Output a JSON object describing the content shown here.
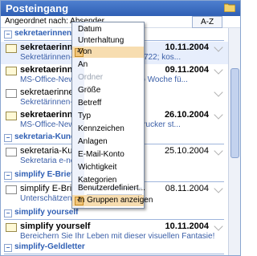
{
  "title": "Posteingang",
  "sort": {
    "label": "Angeordnet nach: Absender",
    "az": "A-Z"
  },
  "groups": [
    {
      "label": "sekretaerinnen...",
      "top": 0
    },
    {
      "label": "sekretaria-Kunde..."
    },
    {
      "label": "simplify E-Brief"
    },
    {
      "label": "simplify yourself"
    },
    {
      "label": "simplify-Geldletter"
    }
  ],
  "messages": [
    {
      "from": "sekretaerinnen...",
      "date": "10.11.2004",
      "preview": "Sekretärinnen-N... übersetzen ‪&#8722; kos...",
      "unread": true
    },
    {
      "from": "sekretaerinnen...",
      "date": "09.11.2004",
      "preview": "MS-Office-Newsl... Office Tipps pro Woche fü...",
      "unread": true
    },
    {
      "from": "sekretaerinnen.d...",
      "date": "",
      "preview": "Sekretärinnen-N... Kollegin?",
      "unread": false
    },
    {
      "from": "sekretaerinnen...",
      "date": "26.10.2004",
      "preview": "MS-Office-Newsl... den richtigen Drucker st...",
      "unread": true
    },
    {
      "from": "sekretaria-Kunde...",
      "date": "25.10.2004",
      "preview": "Sekretaria e-new...",
      "unread": false
    },
    {
      "from": "simplify E-Brief",
      "date": "08.11.2004",
      "preview": "Unterschätzen S...",
      "unread": false
    },
    {
      "from": "simplify yourself",
      "date": "10.11.2004",
      "preview": "Bereichern Sie Ihr Leben mit dieser visuellen Fantasie!",
      "unread": true
    }
  ],
  "menu": {
    "items": [
      {
        "label": "Datum"
      },
      {
        "label": "Unterhaltung"
      },
      {
        "label": "Von",
        "checked": true
      },
      {
        "label": "An"
      },
      {
        "label": "Ordner",
        "disabled": true
      },
      {
        "label": "Größe"
      },
      {
        "label": "Betreff"
      },
      {
        "label": "Typ"
      },
      {
        "label": "Kennzeichen"
      },
      {
        "label": "Anlagen"
      },
      {
        "label": "E-Mail-Konto"
      },
      {
        "label": "Wichtigkeit"
      },
      {
        "label": "Kategorien"
      },
      {
        "label": "Benutzerdefiniert..."
      },
      {
        "label": "In Gruppen anzeigen",
        "checked": true
      }
    ]
  }
}
